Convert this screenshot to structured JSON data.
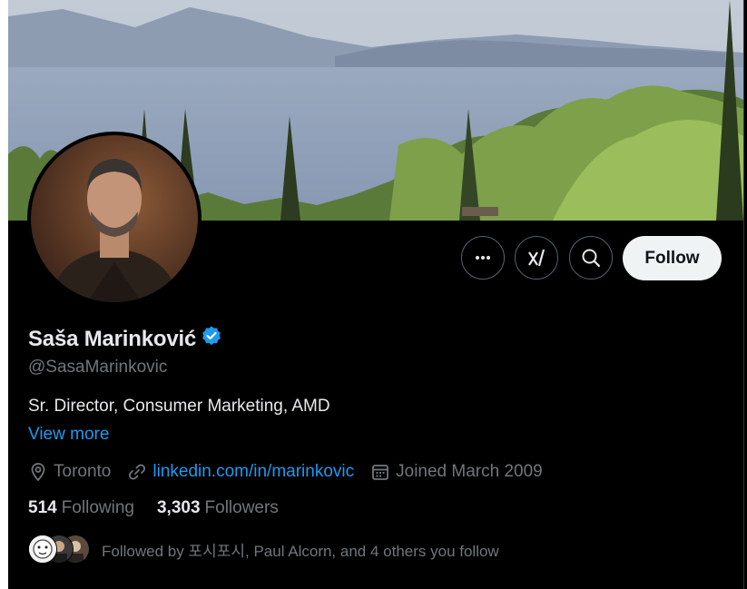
{
  "profile": {
    "display_name": "Saša Marinković",
    "verified": true,
    "handle": "@SasaMarinkovic",
    "bio": "Sr. Director, Consumer Marketing, AMD",
    "view_more": "View more",
    "location": "Toronto",
    "website": "linkedin.com/in/marinkovic",
    "joined": "Joined March 2009"
  },
  "stats": {
    "following_count": "514",
    "following_label": "Following",
    "followers_count": "3,303",
    "followers_label": "Followers"
  },
  "followed_by": {
    "text": "Followed by 포시포시, Paul Alcorn, and 4 others you follow"
  },
  "actions": {
    "follow_label": "Follow",
    "more_icon": "ellipsis-icon",
    "grok_icon": "grok-icon",
    "search_icon": "search-icon"
  },
  "colors": {
    "background": "#000000",
    "accent": "#1d9bf0",
    "follow_button_bg": "#eff3f4",
    "secondary_text": "#71767b"
  }
}
